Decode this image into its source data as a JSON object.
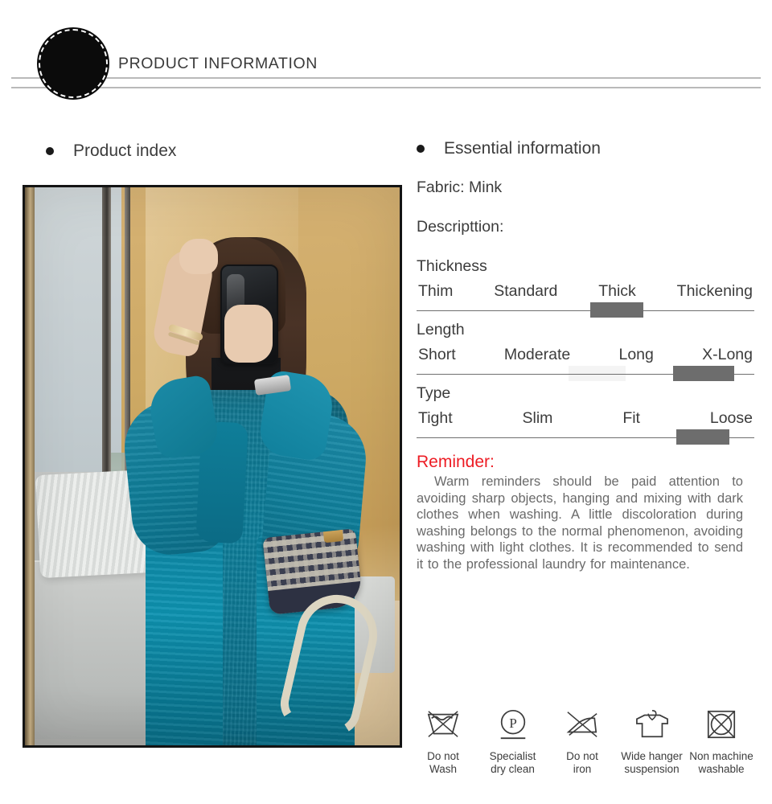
{
  "header": {
    "title": "PRODUCT INFORMATION",
    "dot_icon": "filled-circle-badge-icon"
  },
  "left": {
    "heading": "Product index",
    "bullet_icon": "bullet-dot-icon",
    "photo_alt": "Woman in teal blue long mink fur coat taking a mirror selfie"
  },
  "right": {
    "heading": "Essential information",
    "bullet_icon": "bullet-dot-icon",
    "fabric": "Fabric: Mink",
    "description_label": "Descripttion:",
    "scales": [
      {
        "label": "Thickness",
        "options": [
          "Thim",
          "Standard",
          "Thick",
          "Thickening"
        ],
        "selected": "Thick",
        "marker": {
          "left_pct": 51.5,
          "width_pct": 15.7
        },
        "ghost": null
      },
      {
        "label": "Length",
        "options": [
          "Short",
          "Moderate",
          "Long",
          "X-Long"
        ],
        "selected": "X-Long",
        "marker": {
          "left_pct": 76.0,
          "width_pct": 18.0
        },
        "ghost": {
          "left_pct": 45.0,
          "width_pct": 17.0
        }
      },
      {
        "label": "Type",
        "options": [
          "Tight",
          "Slim",
          "Fit",
          "Loose"
        ],
        "selected": "Loose",
        "marker": {
          "left_pct": 77.0,
          "width_pct": 15.7
        },
        "ghost": null
      }
    ],
    "reminder": {
      "title": "Reminder:",
      "title_color": "#ed1c24",
      "body": "Warm reminders should be paid attention to avoiding sharp objects, hanging and mixing with dark clothes when washing. A little discoloration during washing belongs to the normal phenomenon, avoiding washing with light clothes. It is recommended to send it to the professional laundry for maintenance."
    },
    "care_symbols": [
      {
        "icon": "do-not-wash-icon",
        "label": "Do not\nWash"
      },
      {
        "icon": "specialist-dry-clean-p-icon",
        "label": "Specialist\ndry clean"
      },
      {
        "icon": "do-not-iron-icon",
        "label": "Do not\niron"
      },
      {
        "icon": "wide-hanger-suspension-icon",
        "label": "Wide hanger\nsuspension"
      },
      {
        "icon": "non-machine-washable-icon",
        "label": "Non machine\nwashable"
      }
    ]
  },
  "colors": {
    "coat_teal": "#0e7f9b",
    "reminder_red": "#ed1c24",
    "marker_gray": "#6d6d6d",
    "rule_gray": "#b9b9b9",
    "text_gray": "#3c3c3c"
  }
}
